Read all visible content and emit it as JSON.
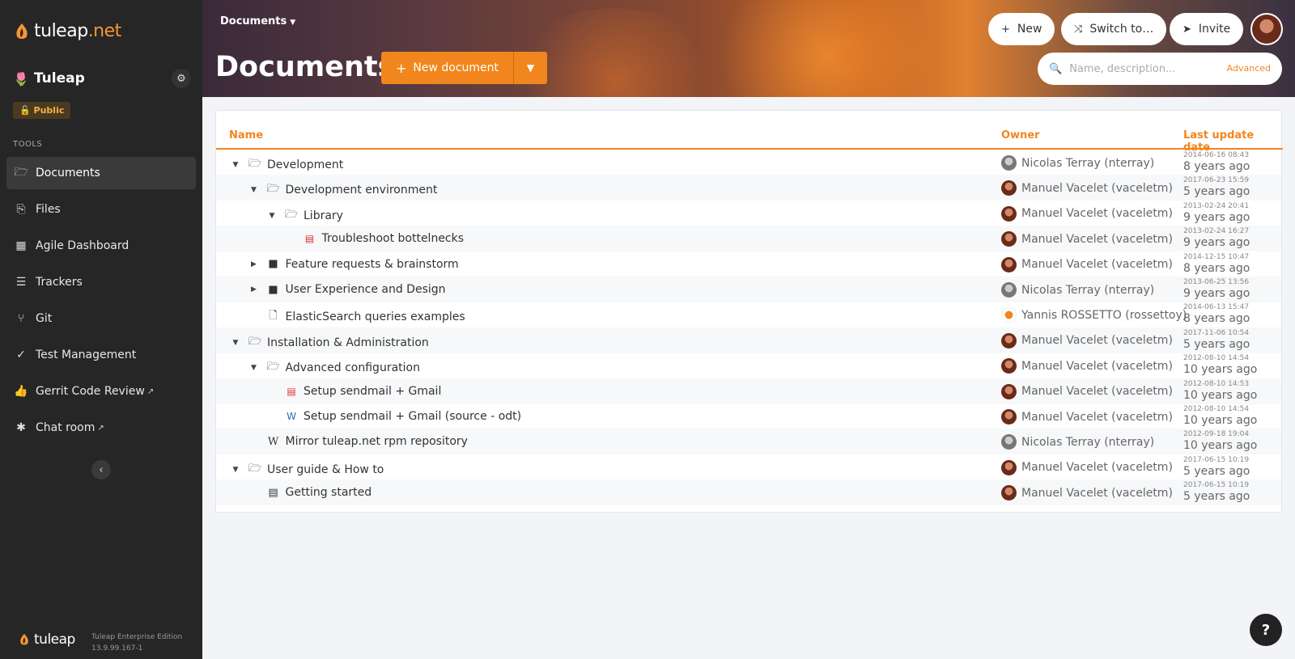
{
  "brand": {
    "name": "tuleap",
    "tld": ".net",
    "accent": "#f1861e"
  },
  "project": {
    "icon": "🌷",
    "name": "Tuleap",
    "visibility": "Public"
  },
  "sidebar": {
    "tools_title": "TOOLS",
    "items": [
      {
        "label": "Documents",
        "icon": "folder-open-icon",
        "glyph": "🗁",
        "active": true,
        "external": false
      },
      {
        "label": "Files",
        "icon": "files-icon",
        "glyph": "⎘",
        "active": false,
        "external": false
      },
      {
        "label": "Agile Dashboard",
        "icon": "table-icon",
        "glyph": "▦",
        "active": false,
        "external": false
      },
      {
        "label": "Trackers",
        "icon": "list-icon",
        "glyph": "☰",
        "active": false,
        "external": false
      },
      {
        "label": "Git",
        "icon": "git-icon",
        "glyph": "⑂",
        "active": false,
        "external": false
      },
      {
        "label": "Test Management",
        "icon": "check-icon",
        "glyph": "✓",
        "active": false,
        "external": false
      },
      {
        "label": "Gerrit Code Review",
        "icon": "thumbs-up-icon",
        "glyph": "👍",
        "active": false,
        "external": true
      },
      {
        "label": "Chat room",
        "icon": "chat-icon",
        "glyph": "✱",
        "active": false,
        "external": true
      }
    ],
    "external_mark": "↗",
    "footer": {
      "logo": "tuleap",
      "edition": "Tuleap Enterprise Edition",
      "version": "13.9.99.167-1"
    }
  },
  "header": {
    "breadcrumb": "Documents",
    "title": "Documents",
    "new_document": "New document",
    "buttons": {
      "new": "New",
      "switch": "Switch to…",
      "invite": "Invite"
    },
    "search": {
      "placeholder": "Name, description...",
      "advanced": "Advanced"
    }
  },
  "table": {
    "columns": {
      "name": "Name",
      "owner": "Owner",
      "date": "Last update date"
    },
    "rows": [
      {
        "name": "Development",
        "level": 0,
        "toggle": "expanded",
        "type": "folder-open",
        "owner": "Nicolas Terray (nterray)",
        "avatar": "nt",
        "date": "2014-06-16 08:43",
        "ago": "8 years ago"
      },
      {
        "name": "Development environment",
        "level": 1,
        "toggle": "expanded",
        "type": "folder-open",
        "owner": "Manuel Vacelet (vaceletm)",
        "avatar": "mv",
        "date": "2017-06-23 15:59",
        "ago": "5 years ago"
      },
      {
        "name": "Library",
        "level": 2,
        "toggle": "expanded",
        "type": "folder-open",
        "owner": "Manuel Vacelet (vaceletm)",
        "avatar": "mv",
        "date": "2013-02-24 20:41",
        "ago": "9 years ago"
      },
      {
        "name": "Troubleshoot bottelnecks",
        "level": 3,
        "toggle": "none",
        "type": "pdf",
        "owner": "Manuel Vacelet (vaceletm)",
        "avatar": "mv",
        "date": "2013-02-24 16:27",
        "ago": "9 years ago"
      },
      {
        "name": "Feature requests & brainstorm",
        "level": 1,
        "toggle": "collapsed",
        "type": "folder",
        "owner": "Manuel Vacelet (vaceletm)",
        "avatar": "mv",
        "date": "2014-12-15 10:47",
        "ago": "8 years ago"
      },
      {
        "name": "User Experience and Design",
        "level": 1,
        "toggle": "collapsed",
        "type": "folder",
        "owner": "Nicolas Terray (nterray)",
        "avatar": "nt",
        "date": "2013-06-25 13:56",
        "ago": "9 years ago"
      },
      {
        "name": "ElasticSearch queries examples",
        "level": 1,
        "toggle": "none",
        "type": "empty",
        "owner": "Yannis ROSSETTO (rossettoy)",
        "avatar": "yr",
        "date": "2014-06-13 15:47",
        "ago": "8 years ago"
      },
      {
        "name": "Installation & Administration",
        "level": 0,
        "toggle": "expanded",
        "type": "folder-open",
        "owner": "Manuel Vacelet (vaceletm)",
        "avatar": "mv",
        "date": "2017-11-06 10:54",
        "ago": "5 years ago"
      },
      {
        "name": "Advanced configuration",
        "level": 1,
        "toggle": "expanded",
        "type": "folder-open",
        "owner": "Manuel Vacelet (vaceletm)",
        "avatar": "mv",
        "date": "2012-08-10 14:54",
        "ago": "10 years ago"
      },
      {
        "name": "Setup sendmail + Gmail",
        "level": 2,
        "toggle": "none",
        "type": "pdf",
        "owner": "Manuel Vacelet (vaceletm)",
        "avatar": "mv",
        "date": "2012-08-10 14:53",
        "ago": "10 years ago"
      },
      {
        "name": "Setup sendmail + Gmail (source - odt)",
        "level": 2,
        "toggle": "none",
        "type": "word",
        "owner": "Manuel Vacelet (vaceletm)",
        "avatar": "mv",
        "date": "2012-08-10 14:54",
        "ago": "10 years ago"
      },
      {
        "name": "Mirror tuleap.net rpm repository",
        "level": 1,
        "toggle": "none",
        "type": "wiki",
        "owner": "Nicolas Terray (nterray)",
        "avatar": "nt",
        "date": "2012-09-18 19:04",
        "ago": "10 years ago"
      },
      {
        "name": "User guide & How to",
        "level": 0,
        "toggle": "expanded",
        "type": "folder-open",
        "owner": "Manuel Vacelet (vaceletm)",
        "avatar": "mv",
        "date": "2017-06-15 10:19",
        "ago": "5 years ago"
      },
      {
        "name": "Getting started",
        "level": 1,
        "toggle": "none",
        "type": "embedded",
        "owner": "Manuel Vacelet (vaceletm)",
        "avatar": "mv",
        "date": "2017-06-15 10:19",
        "ago": "5 years ago"
      }
    ]
  },
  "help": {
    "label": "?"
  }
}
